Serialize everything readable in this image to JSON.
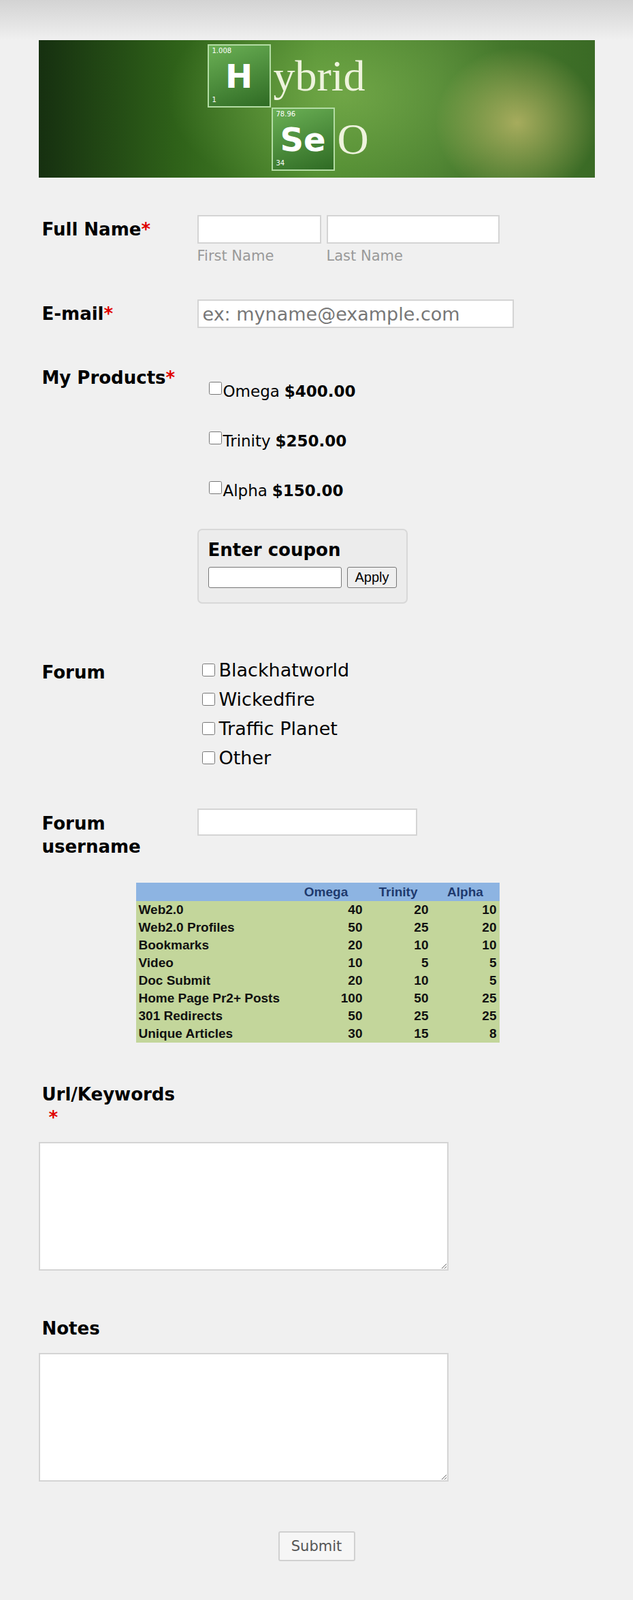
{
  "logo": {
    "tiles": [
      {
        "symbol": "H",
        "mass": "1.008",
        "number": "1",
        "rest": "ybrid"
      },
      {
        "symbol": "Se",
        "mass": "78.96",
        "number": "34",
        "rest": "O"
      }
    ]
  },
  "required_mark": "*",
  "full_name": {
    "label": "Full Name",
    "required": true,
    "fields": [
      {
        "sublabel": "First Name",
        "value": ""
      },
      {
        "sublabel": "Last Name",
        "value": ""
      }
    ]
  },
  "email": {
    "label": "E-mail",
    "required": true,
    "placeholder": "ex: myname@example.com",
    "value": ""
  },
  "products": {
    "label": "My Products",
    "required": true,
    "items": [
      {
        "name": "Omega",
        "price": "$400.00",
        "checked": false
      },
      {
        "name": "Trinity",
        "price": "$250.00",
        "checked": false
      },
      {
        "name": "Alpha",
        "price": "$150.00",
        "checked": false
      }
    ]
  },
  "coupon": {
    "title": "Enter coupon",
    "value": "",
    "button": "Apply"
  },
  "forum": {
    "label": "Forum",
    "required": false,
    "options": [
      {
        "label": "Blackhatworld",
        "checked": false
      },
      {
        "label": "Wickedfire",
        "checked": false
      },
      {
        "label": "Traffic Planet",
        "checked": false
      },
      {
        "label": "Other",
        "checked": false
      }
    ]
  },
  "forum_username": {
    "label": "Forum username",
    "required": false,
    "value": ""
  },
  "table": {
    "columns": [
      "",
      "Omega",
      "Trinity",
      "Alpha"
    ],
    "rows": [
      {
        "label": "Web2.0",
        "values": [
          "40",
          "20",
          "10"
        ]
      },
      {
        "label": "Web2.0 Profiles",
        "values": [
          "50",
          "25",
          "20"
        ]
      },
      {
        "label": "Bookmarks",
        "values": [
          "20",
          "10",
          "10"
        ]
      },
      {
        "label": "Video",
        "values": [
          "10",
          "5",
          "5"
        ]
      },
      {
        "label": "Doc Submit",
        "values": [
          "20",
          "10",
          "5"
        ]
      },
      {
        "label": "Home Page Pr2+ Posts",
        "values": [
          "100",
          "50",
          "25"
        ]
      },
      {
        "label": "301 Redirects",
        "values": [
          "50",
          "25",
          "25"
        ]
      },
      {
        "label": "Unique Articles",
        "values": [
          "30",
          "15",
          "8"
        ]
      }
    ]
  },
  "url_keywords": {
    "label": "Url/Keywords",
    "required": true,
    "value": ""
  },
  "notes": {
    "label": "Notes",
    "required": false,
    "value": ""
  },
  "submit": "Submit"
}
